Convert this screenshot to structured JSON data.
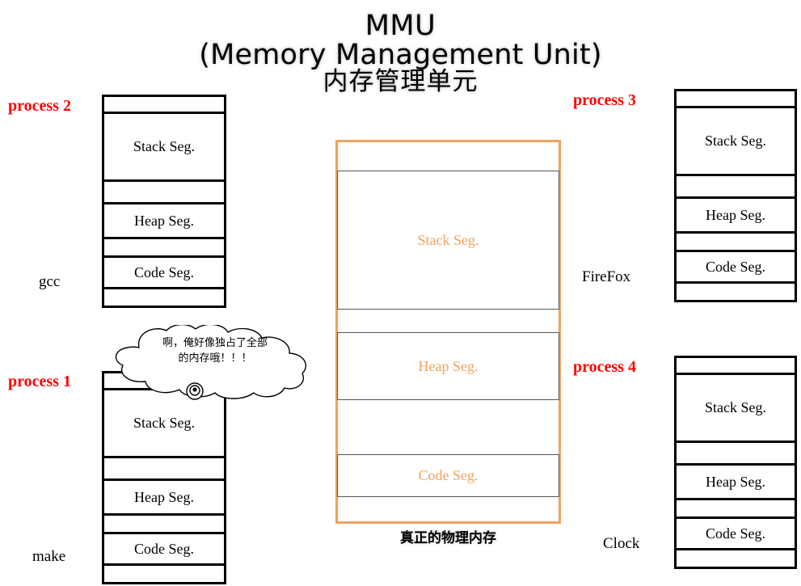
{
  "title": {
    "line1": "MMU",
    "line2": "(Memory Management Unit)",
    "line3": "内存管理单元"
  },
  "segment_labels": {
    "stack": "Stack Seg.",
    "heap": "Heap Seg.",
    "code": "Code Seg."
  },
  "colors": {
    "process_tag": "#FF0000",
    "physical_memory_border": "#F2A15C",
    "physical_memory_text": "#F2A15C",
    "process_border": "#000000",
    "background": "#FFFFFF"
  },
  "processes": [
    {
      "tag": "process 2",
      "program": "gcc",
      "rows": [
        "",
        "Stack Seg.",
        "",
        "Heap Seg.",
        "",
        "Code Seg.",
        ""
      ]
    },
    {
      "tag": "process 1",
      "program": "make",
      "rows": [
        "",
        "Stack Seg.",
        "",
        "Heap Seg.",
        "",
        "Code Seg.",
        ""
      ]
    },
    {
      "tag": "process 3",
      "program": "FireFox",
      "rows": [
        "",
        "Stack Seg.",
        "",
        "Heap Seg.",
        "",
        "Code Seg.",
        ""
      ]
    },
    {
      "tag": "process 4",
      "program": "Clock",
      "rows": [
        "",
        "Stack Seg.",
        "",
        "Heap Seg.",
        "",
        "Code Seg.",
        ""
      ]
    }
  ],
  "physical_memory": {
    "caption": "真正的物理内存",
    "segments": [
      {
        "label": "Stack Seg."
      },
      {
        "label": "Heap Seg."
      },
      {
        "label": "Code Seg."
      }
    ]
  },
  "thought_bubble": {
    "line1": "啊，俺好像独占了全部",
    "line2": "的内存哦！！！"
  }
}
